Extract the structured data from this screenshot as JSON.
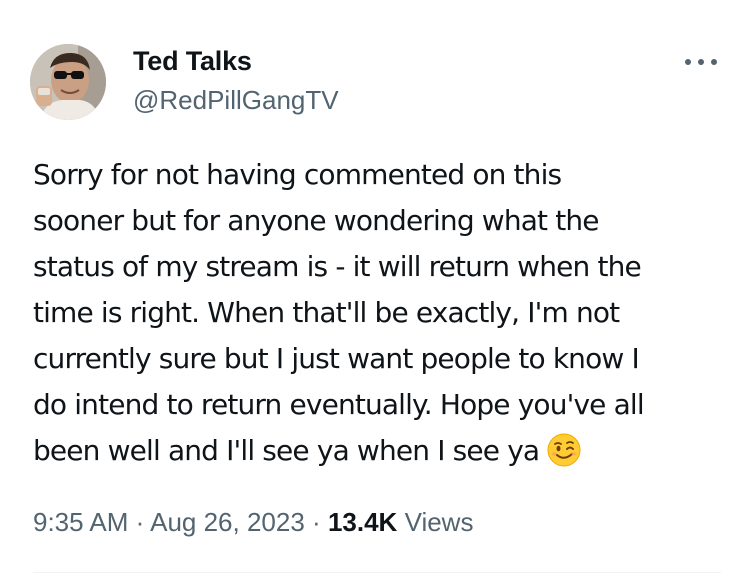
{
  "author": {
    "display_name": "Ted Talks",
    "handle": "@RedPillGangTV",
    "avatar_icon": "profile-photo"
  },
  "more_icon": "more-horizontal-icon",
  "tweet": {
    "text": "Sorry for not having commented on this\nsooner but for anyone wondering what the\nstatus of my stream is - it will return when the\ntime is right. When that'll be exactly, I'm not\ncurrently sure but I just want people to know I\ndo intend to return eventually. Hope you've all\nbeen well and I'll see ya when I see ya",
    "emoji": "winking-face-emoji"
  },
  "meta": {
    "time": "9:35 AM",
    "separator": "·",
    "date": "Aug 26, 2023",
    "views_count": "13.4K",
    "views_label": "Views"
  },
  "colors": {
    "text_primary": "#0f1419",
    "text_secondary": "#536471",
    "divider": "#eff3f4",
    "emoji_face": "#ffcc33"
  }
}
